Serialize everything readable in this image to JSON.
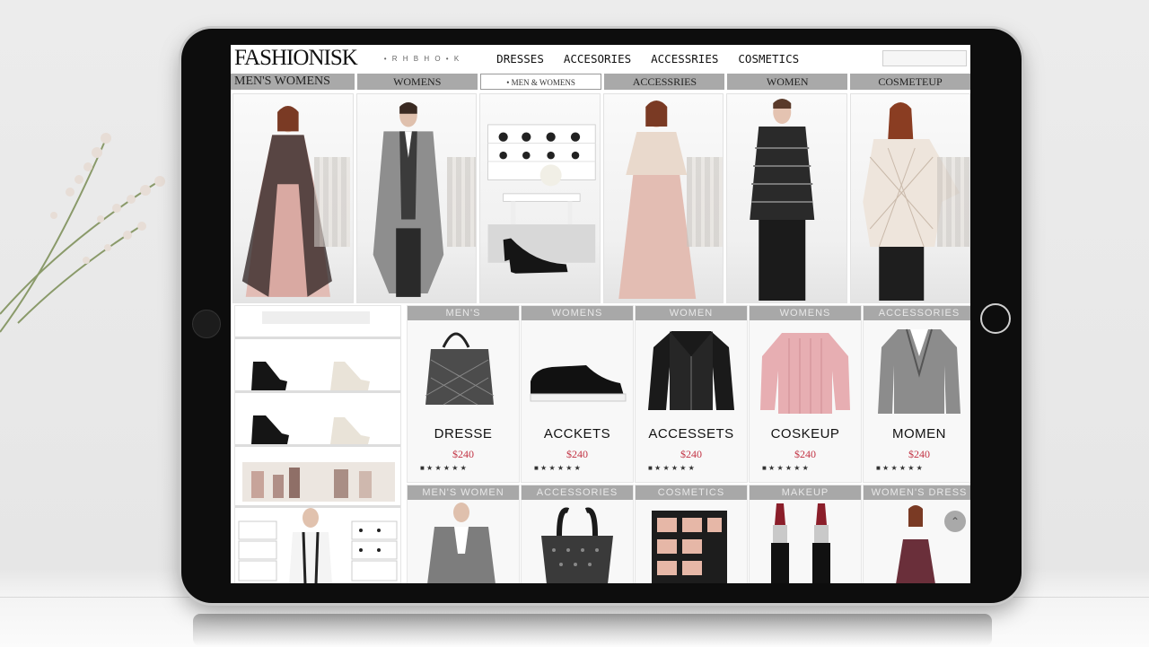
{
  "header": {
    "logo": "FASHIONISK",
    "mini_text": "• R H B H O • K",
    "nav": [
      "DRESSES",
      "ACCESORIES",
      "ACCESSRIES",
      "COSMETICS"
    ]
  },
  "category_bar": [
    {
      "label": "MEN'S WOMENS"
    },
    {
      "label": "WOMENS"
    },
    {
      "label": "• MEN & WOMENS"
    },
    {
      "label": "ACCESSRIES"
    },
    {
      "label": "WOMEN"
    },
    {
      "label": "COSMETEUP"
    }
  ],
  "lower_row1": [
    {
      "header": "MEN'S",
      "name": "DRESSE",
      "price": "$240",
      "meta": "■ ★ ★ ★ ★ ★"
    },
    {
      "header": "WOMENS",
      "name": "ACCKETS",
      "price": "$240",
      "meta": "■ ★ ★ ★ ★ ★"
    },
    {
      "header": "WOMEN",
      "name": "ACCESSETS",
      "price": "$240",
      "meta": "■ ★ ★ ★ ★ ★"
    },
    {
      "header": "WOMENS",
      "name": "COSKEUP",
      "price": "$240",
      "meta": "■ ★ ★ ★ ★ ★"
    },
    {
      "header": "ACCESSORIES",
      "name": "MOMEN",
      "price": "$240",
      "meta": "■ ★ ★ ★ ★ ★"
    }
  ],
  "lower_row2_headers": [
    "MEN'S WOMEN",
    "ACCESSORIES",
    "COSMETICS",
    "MAKEUP",
    "WOMEN'S DRESS"
  ],
  "colors": {
    "accent_price": "#c23344",
    "bar_gray": "#a9a9a9"
  }
}
